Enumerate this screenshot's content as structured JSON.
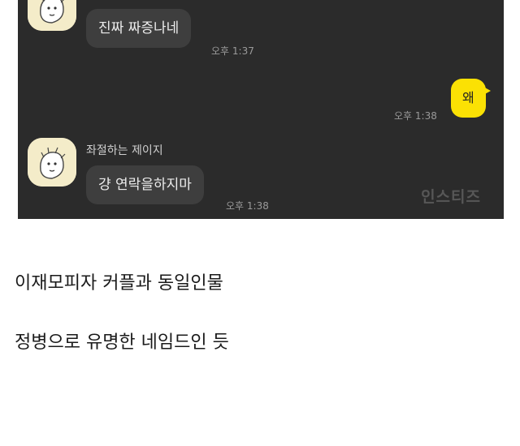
{
  "chat": {
    "messages": [
      {
        "text": "진짜 짜증나네",
        "time": "오후 1:37"
      },
      {
        "text": "왜",
        "time": "오후 1:38"
      },
      {
        "sender": "좌절하는 제이지",
        "text": "걍 연락을하지마",
        "time": "오후 1:38"
      }
    ],
    "watermark": "인스티즈"
  },
  "captions": {
    "line1": "이재모피자 커플과 동일인물",
    "line2": "정병으로 유명한 네임드인 듯"
  },
  "colors": {
    "chat_background": "#2b2b2b",
    "incoming_bubble": "#3e3e3e",
    "outgoing_bubble": "#fbe104"
  }
}
